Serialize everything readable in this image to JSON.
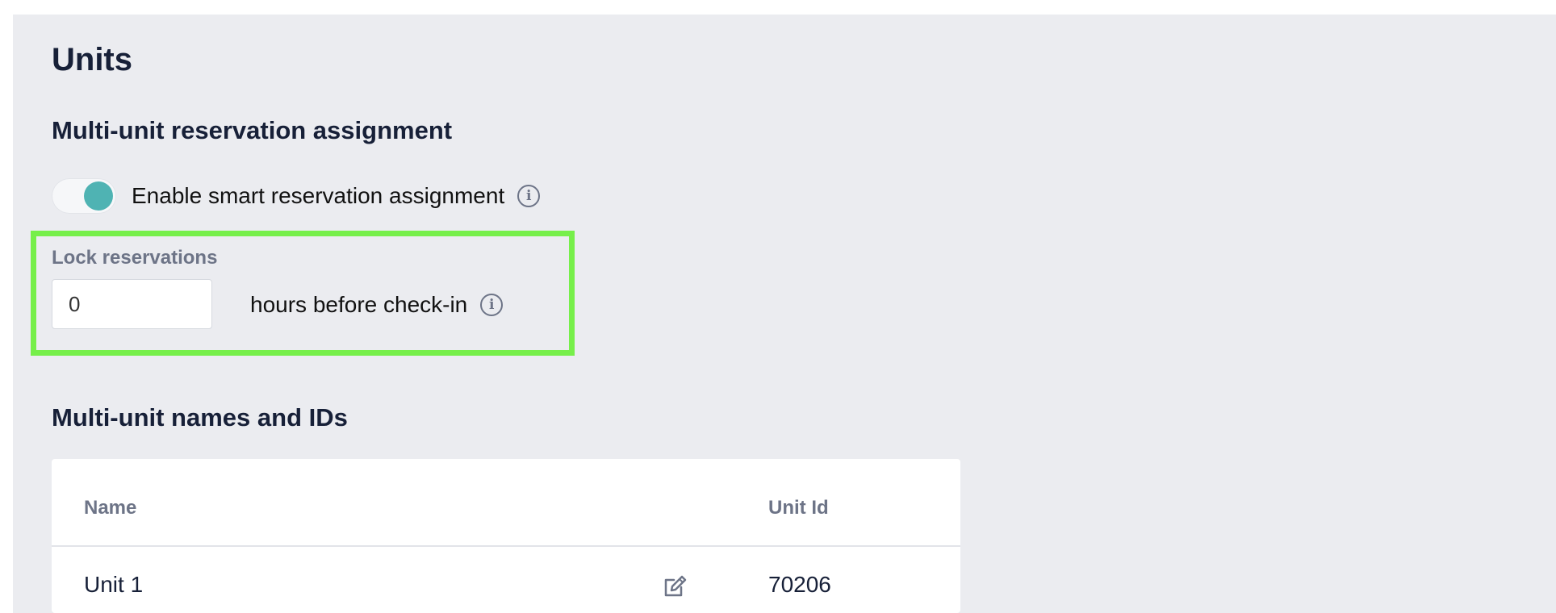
{
  "page": {
    "title": "Units"
  },
  "assignment": {
    "section_title": "Multi-unit reservation assignment",
    "toggle_label": "Enable smart reservation assignment",
    "toggle_on": true,
    "info_icon": "info-icon"
  },
  "lock": {
    "label": "Lock reservations",
    "value": "0",
    "suffix": "hours before check-in",
    "info_icon": "info-icon"
  },
  "units_table": {
    "section_title": "Multi-unit names and IDs",
    "columns": [
      "Name",
      "Unit Id"
    ],
    "rows": [
      {
        "name": "Unit 1",
        "unit_id": "70206",
        "edit_icon": "edit-icon"
      }
    ]
  },
  "colors": {
    "accent": "#4fb3b3",
    "highlight": "#76ef4a",
    "background": "#ebecf0",
    "heading": "#172038",
    "muted": "#6d7487"
  }
}
